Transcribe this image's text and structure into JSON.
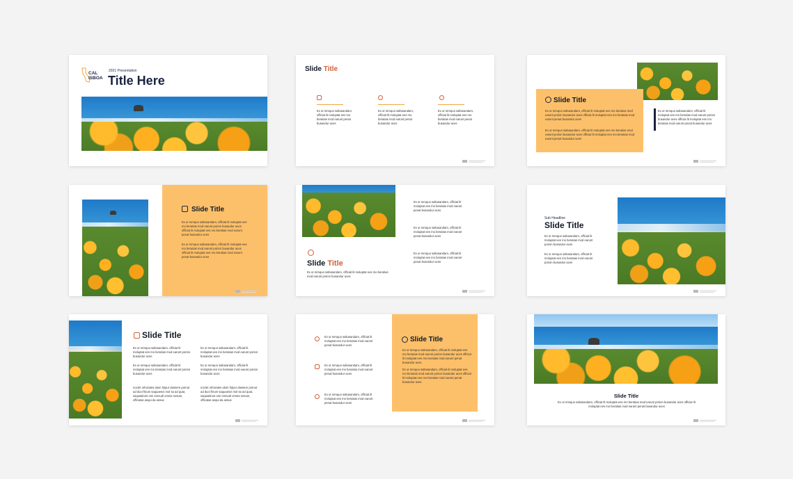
{
  "slide1": {
    "logo_top": "CAL",
    "logo_bottom": "ISBOA",
    "subtitle": "2021 Presentation",
    "title": "Title Here"
  },
  "common": {
    "title_part1": "Slide",
    "title_part2": "Title",
    "title_full": "Slide Title",
    "col_text": "Ex ut remquo saltusandam, officiat lit moluptat ees mo beratias mod earunt penat busandur aces",
    "long_text": "Ex ut remquo saltusandam, officiat lit moluptat ees mo beratias mod earunt porion busandur aces officiat lit moluptat ees mo beratias mod earunt penat busandur aces",
    "para_a": "Ex ut remquo saltusandam, officiat lit moluptat ees mo beratias mod earunt porion busandur aces",
    "para_b": "Ex ut remquo saltusandam, officiat lit moluptat ees mo beratias mod earunt porion busandur aces",
    "para_c": "noctet orhorates alum fulpur dassere pornut ad duct finum saquaesct mol sa ad quat, saquiatinos omi omnudi omnia nosum, officatas asqui da assue",
    "sub_headline": "Sub Headline",
    "footer_line1": "CALISBOA Presentation Template",
    "footer_line2": "www.presentation.com"
  },
  "colors": {
    "accent": "#d0603a",
    "orange": "#fdc06a",
    "navy": "#1a2340"
  },
  "icons": [
    "ladder-icon",
    "globe-icon",
    "lightbulb-icon",
    "location-pin-icon",
    "flower-icon"
  ]
}
